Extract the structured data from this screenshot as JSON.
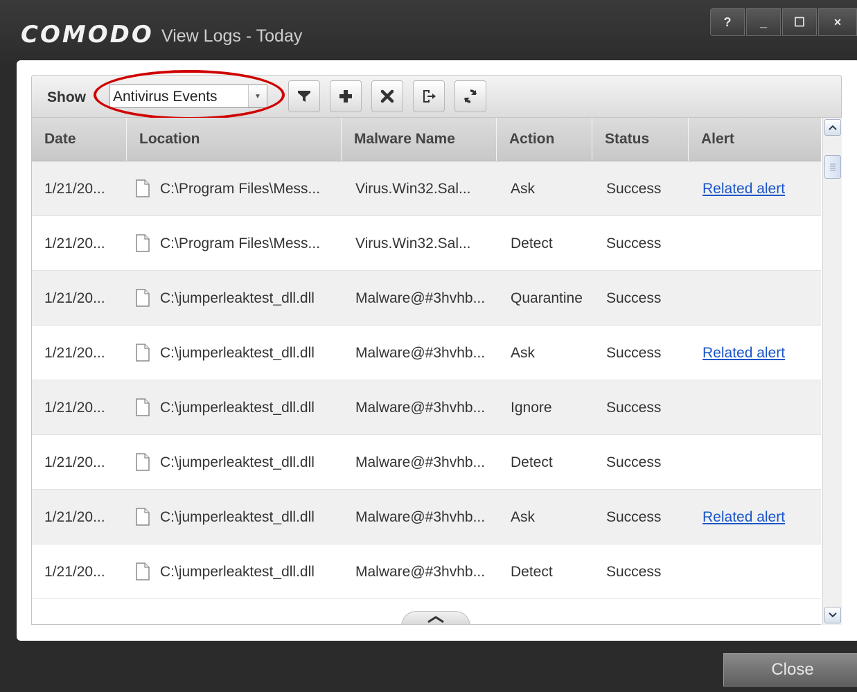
{
  "window": {
    "brand": "COMODO",
    "title": "View Logs - Today",
    "buttons": {
      "help": "?",
      "minimize": "_",
      "maximize": "☐",
      "close": "×"
    }
  },
  "toolbar": {
    "show_label": "Show",
    "filter_select": {
      "value": "Antivirus Events"
    },
    "icons": [
      "filter-icon",
      "add-icon",
      "delete-icon",
      "export-icon",
      "refresh-icon"
    ]
  },
  "table": {
    "columns": [
      "Date",
      "Location",
      "Malware Name",
      "Action",
      "Status",
      "Alert"
    ],
    "rows": [
      {
        "date": "1/21/20...",
        "location": "C:\\Program Files\\Mess...",
        "malware": "Virus.Win32.Sal...",
        "action": "Ask",
        "status": "Success",
        "alert": "Related alert"
      },
      {
        "date": "1/21/20...",
        "location": "C:\\Program Files\\Mess...",
        "malware": "Virus.Win32.Sal...",
        "action": "Detect",
        "status": "Success",
        "alert": ""
      },
      {
        "date": "1/21/20...",
        "location": "C:\\jumperleaktest_dll.dll",
        "malware": "Malware@#3hvhb...",
        "action": "Quarantine",
        "status": "Success",
        "alert": ""
      },
      {
        "date": "1/21/20...",
        "location": "C:\\jumperleaktest_dll.dll",
        "malware": "Malware@#3hvhb...",
        "action": "Ask",
        "status": "Success",
        "alert": "Related alert"
      },
      {
        "date": "1/21/20...",
        "location": "C:\\jumperleaktest_dll.dll",
        "malware": "Malware@#3hvhb...",
        "action": "Ignore",
        "status": "Success",
        "alert": ""
      },
      {
        "date": "1/21/20...",
        "location": "C:\\jumperleaktest_dll.dll",
        "malware": "Malware@#3hvhb...",
        "action": "Detect",
        "status": "Success",
        "alert": ""
      },
      {
        "date": "1/21/20...",
        "location": "C:\\jumperleaktest_dll.dll",
        "malware": "Malware@#3hvhb...",
        "action": "Ask",
        "status": "Success",
        "alert": "Related alert"
      },
      {
        "date": "1/21/20...",
        "location": "C:\\jumperleaktest_dll.dll",
        "malware": "Malware@#3hvhb...",
        "action": "Detect",
        "status": "Success",
        "alert": ""
      }
    ]
  },
  "footer": {
    "close_label": "Close"
  },
  "colors": {
    "highlight": "#d00000",
    "link": "#1a55c9",
    "titlebar": "#2f2f2f"
  }
}
